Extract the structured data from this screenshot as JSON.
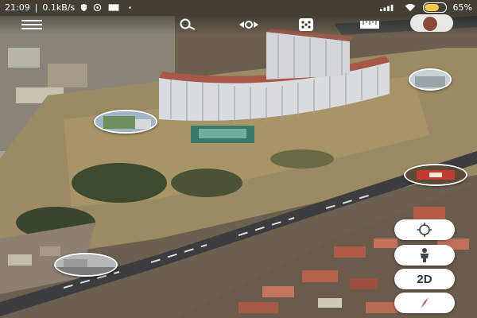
{
  "status_bar": {
    "time": "21:09",
    "separator": "|",
    "network_speed": "0.1kB/s",
    "battery_percent": "65%",
    "battery_level": 0.65,
    "left_icons": [
      "shield-icon",
      "target-icon",
      "notification-box-icon",
      "dot-icon"
    ],
    "right_icons": [
      "signal-icon",
      "wifi-icon",
      "battery-icon"
    ]
  },
  "toolbar": {
    "icons": [
      "menu-icon",
      "search-icon",
      "satellite-icon",
      "dice-icon",
      "ruler-icon",
      "user-avatar"
    ]
  },
  "map_controls": {
    "compass_recenter_icon": "crosshair-icon",
    "street_view_icon": "pegman-icon",
    "view_mode_label": "2D",
    "north_icon": "compass-needle-icon"
  },
  "photo_thumbnails": [
    "thumbnail-building-left",
    "thumbnail-building-right",
    "thumbnail-restaurant",
    "thumbnail-street"
  ],
  "colors": {
    "accent_red": "#e0533a",
    "control_bg": "#ffffff",
    "battery_fill": "#f0c84a"
  }
}
